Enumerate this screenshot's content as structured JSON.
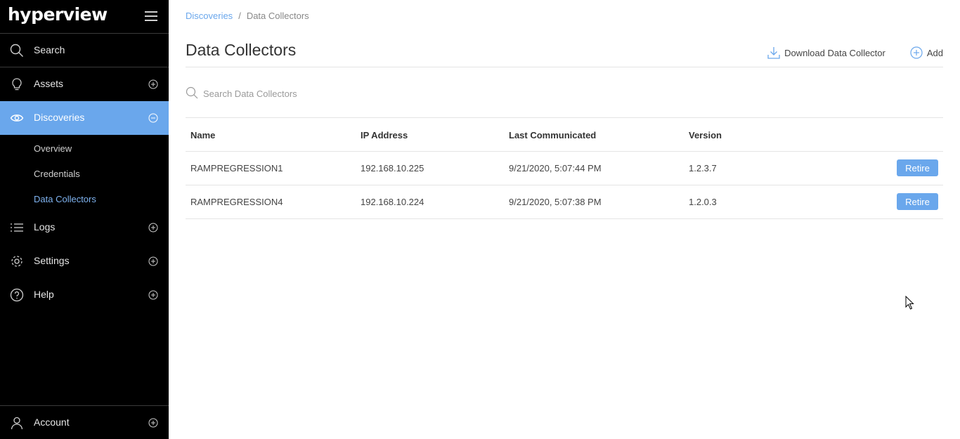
{
  "sidebar": {
    "logo": "hyperview",
    "search_label": "Search",
    "items": [
      {
        "label": "Assets",
        "icon": "lightbulb-icon"
      },
      {
        "label": "Discoveries",
        "icon": "eye-icon"
      },
      {
        "label": "Logs",
        "icon": "list-icon"
      },
      {
        "label": "Settings",
        "icon": "gear-icon"
      },
      {
        "label": "Help",
        "icon": "question-icon"
      }
    ],
    "discoveries_sub": [
      "Overview",
      "Credentials",
      "Data Collectors"
    ],
    "account_label": "Account"
  },
  "breadcrumb": {
    "parent": "Discoveries",
    "separator": "/",
    "current": "Data Collectors"
  },
  "page": {
    "title": "Data Collectors",
    "download_label": "Download Data Collector",
    "add_label": "Add"
  },
  "search": {
    "placeholder": "Search Data Collectors"
  },
  "table": {
    "headers": [
      "Name",
      "IP Address",
      "Last Communicated",
      "Version"
    ],
    "rows": [
      {
        "name": "RAMPREGRESSION1",
        "ip": "192.168.10.225",
        "last": "9/21/2020, 5:07:44 PM",
        "version": "1.2.3.7",
        "action": "Retire"
      },
      {
        "name": "RAMPREGRESSION4",
        "ip": "192.168.10.224",
        "last": "9/21/2020, 5:07:38 PM",
        "version": "1.2.0.3",
        "action": "Retire"
      }
    ]
  },
  "colors": {
    "accent": "#6aa7ec",
    "sidebar_bg": "#000000"
  }
}
